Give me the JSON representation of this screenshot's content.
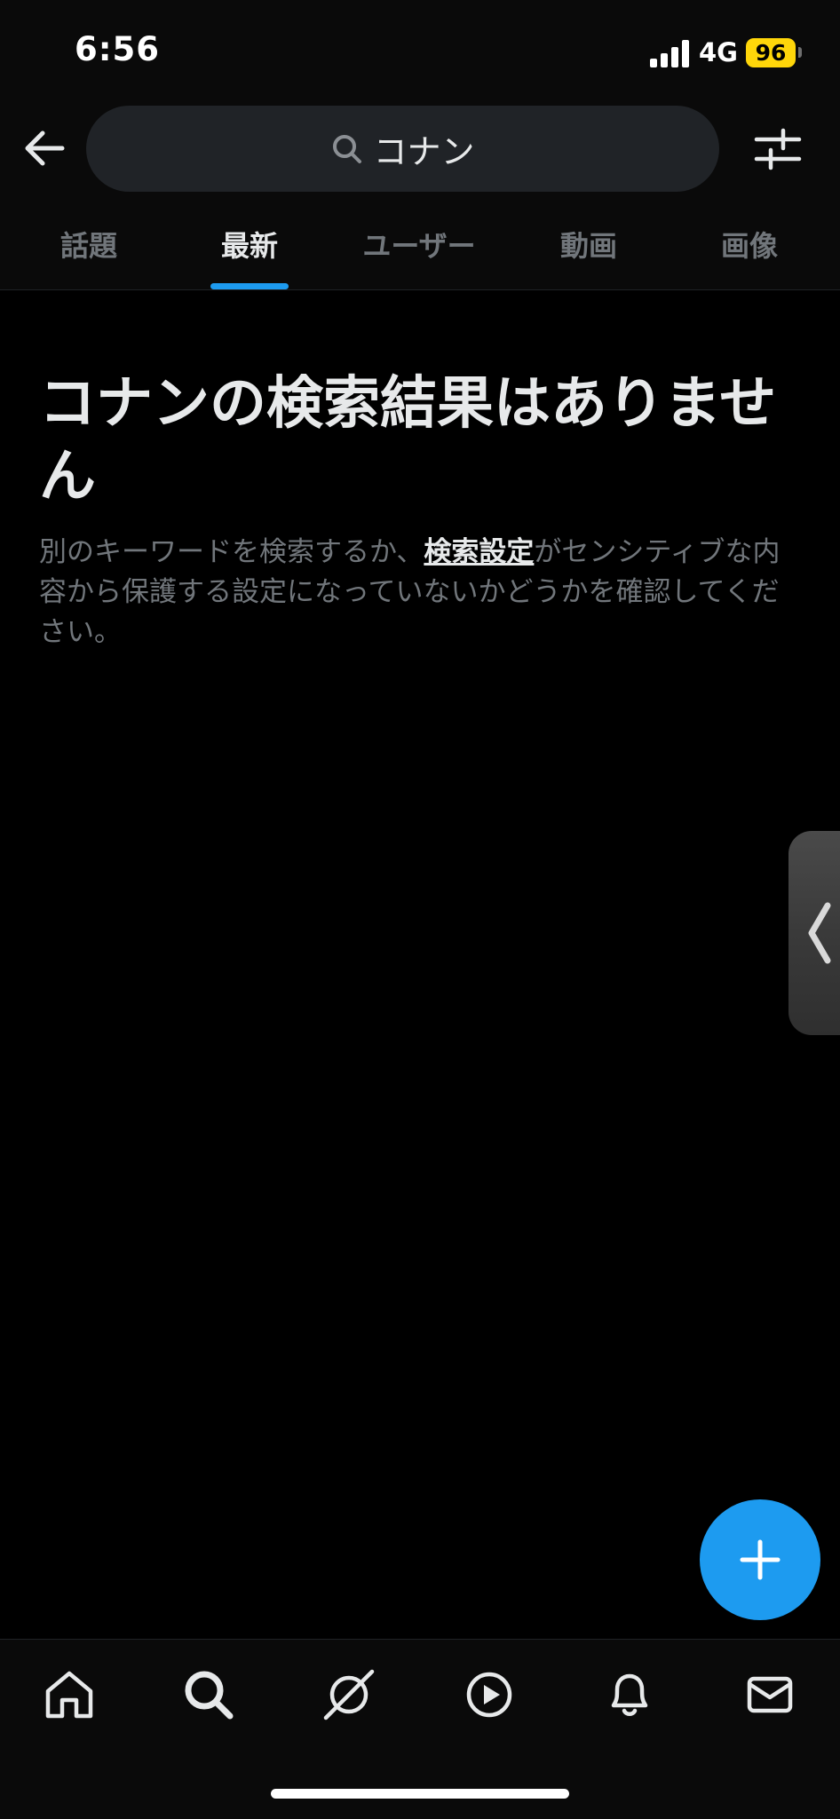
{
  "status_bar": {
    "time": "6:56",
    "network": "4G",
    "battery": "96"
  },
  "search": {
    "query": "コナン"
  },
  "tabs": [
    {
      "label": "話題",
      "active": false
    },
    {
      "label": "最新",
      "active": true
    },
    {
      "label": "ユーザー",
      "active": false
    },
    {
      "label": "動画",
      "active": false
    },
    {
      "label": "画像",
      "active": false
    }
  ],
  "empty_state": {
    "title": "コナンの検索結果はありません",
    "description_before": "別のキーワードを検索するか、",
    "link_text": "検索設定",
    "description_after": "がセンシティブな内容から保護する設定になっていないかどうかを確認してください。"
  },
  "bottom_nav": [
    {
      "icon": "home-icon"
    },
    {
      "icon": "search-icon"
    },
    {
      "icon": "grok-icon"
    },
    {
      "icon": "video-icon"
    },
    {
      "icon": "notifications-icon"
    },
    {
      "icon": "messages-icon"
    }
  ],
  "colors": {
    "accent": "#1d9bf0",
    "background": "#000000",
    "text_primary": "#e7e9ea",
    "text_secondary": "#71767b",
    "battery": "#ffd60a"
  }
}
